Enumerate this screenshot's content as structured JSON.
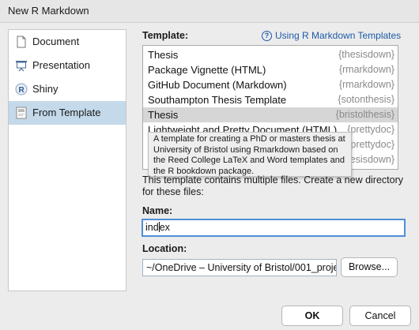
{
  "window": {
    "title": "New R Markdown"
  },
  "nav": {
    "items": [
      {
        "label": "Document",
        "icon": "document-icon",
        "selected": false
      },
      {
        "label": "Presentation",
        "icon": "presentation-icon",
        "selected": false
      },
      {
        "label": "Shiny",
        "icon": "shiny-r-icon",
        "selected": false
      },
      {
        "label": "From Template",
        "icon": "template-icon",
        "selected": true
      }
    ]
  },
  "template": {
    "label": "Template:",
    "help_link": "Using R Markdown Templates",
    "items": [
      {
        "name": "Thesis",
        "package": "{thesisdown}",
        "selected": false
      },
      {
        "name": "Package Vignette (HTML)",
        "package": "{rmarkdown}",
        "selected": false
      },
      {
        "name": "GitHub Document (Markdown)",
        "package": "{rmarkdown}",
        "selected": false
      },
      {
        "name": "Southampton Thesis Template",
        "package": "{sotonthesis}",
        "selected": false
      },
      {
        "name": "Thesis",
        "package": "{bristolthesis}",
        "selected": true
      },
      {
        "name": "Lightweight and Pretty Document (HTML)",
        "package": "{prettydoc}",
        "selected": false
      },
      {
        "name": "",
        "package": "{prettydoc}",
        "selected": false
      },
      {
        "name": "",
        "package": "{thesisdown}",
        "selected": false
      }
    ],
    "tooltip": "A template for creating a PhD or masters thesis at University of Bristol using Rmarkdown based on the Reed College LaTeX and Word templates and the R bookdown package."
  },
  "note": "This template contains multiple files. Create a new directory for these files:",
  "name_field": {
    "label": "Name:",
    "before_caret": "ind",
    "after_caret": "ex"
  },
  "location_field": {
    "label": "Location:",
    "value": "~/OneDrive – University of Bristol/001_proje",
    "browse_label": "Browse..."
  },
  "buttons": {
    "ok": "OK",
    "cancel": "Cancel"
  },
  "colors": {
    "nav_selected": "#c4d9ea",
    "list_selected": "#d6d6d6",
    "link": "#1d5aa8",
    "focus_ring": "#4f8fd6"
  }
}
